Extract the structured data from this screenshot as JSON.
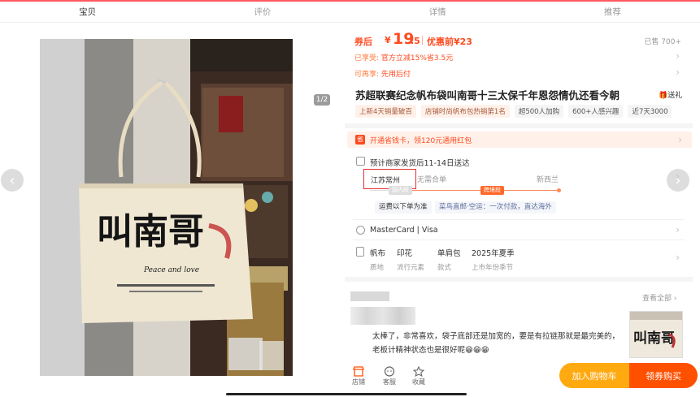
{
  "tabs": [
    "宝贝",
    "评价",
    "详情",
    "推荐"
  ],
  "gallery": {
    "pager": "1/2",
    "prev": "‹",
    "next": "›"
  },
  "product_image": {
    "bag_text": "叫南哥",
    "bag_subtitle": "Peace and love"
  },
  "price": {
    "after_coupon_label": "券后",
    "currency": "¥",
    "amount_int": "19",
    "amount_dec": ".5",
    "original_label": "优惠前¥23",
    "sold": "已售 700+"
  },
  "promos": [
    {
      "key": "已享受:",
      "text": "官方立减15%省3.5元"
    },
    {
      "key": "可再享:",
      "text": "先用后付"
    }
  ],
  "title": "苏超联赛纪念帆布袋叫南哥十三太保千年恩怨情仇还看今朝",
  "gift": "送礼",
  "chips": [
    {
      "text": "上新4天销量破百",
      "style": "warm"
    },
    {
      "text": "店铺时尚帆布包热销第1名",
      "style": "warm"
    },
    {
      "text": "超500人加购",
      "style": "grey"
    },
    {
      "text": "600+人感兴趣",
      "style": "grey"
    },
    {
      "text": "近7天3000",
      "style": "grey"
    }
  ],
  "vip": {
    "icon": "省",
    "text": "开通省钱卡，领120元通用红包"
  },
  "shipping": {
    "text": "预计商家发货后11-14日送达",
    "from": "江苏常州",
    "merge": "无需合单",
    "dest": "新西兰",
    "seg_a": "国内段",
    "seg_b": "跨境段",
    "tag1": "运费以下单为准",
    "tag2": "菜鸟直邮·空运：一次付款，直达海外"
  },
  "payment": "MasterCard | Visa",
  "attributes": [
    {
      "value": "帆布",
      "key": "质地"
    },
    {
      "value": "印花",
      "key": "流行元素"
    },
    {
      "value": "单肩包",
      "key": "款式"
    },
    {
      "value": "2025年夏季",
      "key": "上市年份季节"
    }
  ],
  "review": {
    "see_all": "查看全部",
    "text": "太棒了，非常喜欢，袋子底部还是加宽的，要是有拉链那就是最完美的，老板计精神状态也是很好呢😁😁😁",
    "thumb_text": "叫南哥"
  },
  "bottom": {
    "shop": "店铺",
    "service": "客服",
    "fav": "收藏",
    "cart": "加入购物车",
    "buy": "领券购买"
  },
  "colors": {
    "accent": "#ff4a1f",
    "cart": "#ffaa11",
    "buy": "#ff5000"
  }
}
